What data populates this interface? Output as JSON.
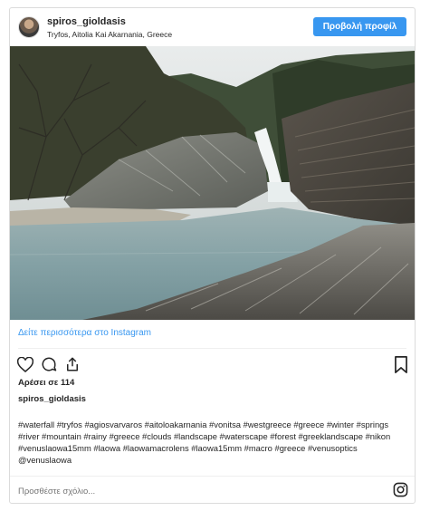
{
  "header": {
    "username": "spiros_gioldasis",
    "location": "Tryfos, Aitolia Kai Akarnania, Greece",
    "profile_button": "Προβολή προφίλ"
  },
  "photo": {
    "subject": "waterfall",
    "icon": "photo"
  },
  "view_more": "Δείτε περισσότερα στο Instagram",
  "actions": {
    "like_icon": "heart-icon",
    "comment_icon": "comment-icon",
    "share_icon": "share-icon",
    "save_icon": "bookmark-icon"
  },
  "likes": "Αρέσει σε 114",
  "caption": {
    "author": "spiros_gioldasis",
    "text": "#waterfall #tryfos #agiosvarvaros #aitoloakarnania #vonitsa #westgreece #greece #winter #springs #river #mountain #rainy #greece #clouds #landscape #waterscape #forest #greeklandscape #nikon #venuslaowa15mm #laowa #laowamacrolens #laowa15mm #macro #greece #venusoptics @venuslaowa"
  },
  "comment": {
    "placeholder": "Προσθέστε σχόλιο..."
  },
  "colors": {
    "accent": "#3897f0",
    "border": "#dbdbdb"
  }
}
